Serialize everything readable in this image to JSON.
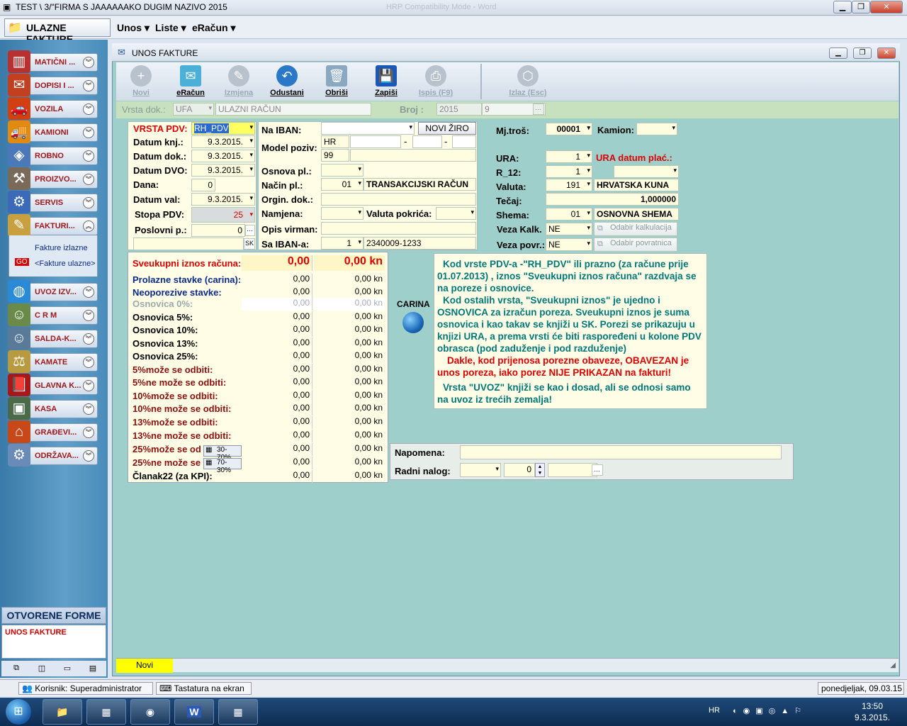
{
  "window": {
    "title": "TEST \\ 3/\"FIRMA S JAAAAAAKO DUGIM NAZIVO  2015",
    "faded_title": "HRP Compatibility Mode - Word"
  },
  "menu": {
    "app_label": "ULAZNE FAKTURE",
    "items": [
      "Unos",
      "Liste",
      "eRačun"
    ]
  },
  "sidebar": {
    "items": [
      "MATIČNI ...",
      "DOPISI I ...",
      "VOZILA",
      "KAMIONI",
      "ROBNO",
      "PROIZVO...",
      "SERVIS",
      "FAKTURI...",
      "UVOZ IZV...",
      "C R M",
      "SALDA-K...",
      "KAMATE",
      "GLAVNA K...",
      "KASA",
      "GRAĐEVI...",
      "ODRŽAVA..."
    ],
    "sub_items": [
      "Fakture izlazne",
      "<Fakture ulazne>"
    ],
    "open_forms_title": "OTVORENE FORME",
    "open_forms": [
      "UNOS FAKTURE"
    ]
  },
  "form": {
    "title": "UNOS FAKTURE",
    "toolbar": [
      {
        "label": "Novi",
        "enabled": false
      },
      {
        "label": "eRačun",
        "enabled": true
      },
      {
        "label": "Izmjena",
        "enabled": false
      },
      {
        "label": "Odustani",
        "enabled": true
      },
      {
        "label": "Obriši",
        "enabled": true
      },
      {
        "label": "Zapiši",
        "enabled": true
      },
      {
        "label": "Ispis (F9)",
        "enabled": false
      },
      {
        "label": "Izlaz (Esc)",
        "enabled": false
      }
    ],
    "header": {
      "vrsta_label": "Vrsta dok.:",
      "vrsta_code": "UFA",
      "vrsta_name": "ULAZNI RAČUN",
      "broj_label": "Broj :",
      "broj_year": "2015",
      "broj_num": "9"
    },
    "left": {
      "vrsta_pdv_label": "VRSTA PDV:",
      "vrsta_pdv": "RH_PDV",
      "datum_knj_label": "Datum knj.:",
      "datum_knj": "9.3.2015.",
      "datum_dok_label": "Datum dok.:",
      "datum_dok": "9.3.2015.",
      "datum_dvo_label": "Datum DVO:",
      "datum_dvo": "9.3.2015.",
      "dana_label": "Dana:",
      "dana": "0",
      "datum_val_label": "Datum val:",
      "datum_val": "9.3.2015.",
      "stopa_label": "Stopa PDV:",
      "stopa": "25",
      "poslovni_label": "Poslovni p.:",
      "poslovni": "0",
      "sk": "SK"
    },
    "mid": {
      "iban_label": "Na IBAN:",
      "novi_ziro": "NOVI ŽIRO",
      "model_label": "Model poziv:",
      "model_hr": "HR",
      "model_99": "99",
      "osnova_label": "Osnova pl.:",
      "nacin_label": "Način pl.:",
      "nacin_code": "01",
      "nacin_name": "TRANSAKCIJSKI RAČUN",
      "orgin_label": "Orgin. dok.:",
      "namjena_label": "Namjena:",
      "valuta_pok_label": "Valuta pokrića:",
      "opis_label": "Opis virman:",
      "sa_iban_label": "Sa IBAN-a:",
      "sa_iban_code": "1",
      "sa_iban": "2340009-1233"
    },
    "right": {
      "mjtros_label": "Mj.troš:",
      "mjtros": "00001",
      "kamion_label": "Kamion:",
      "ura_label": "URA:",
      "ura": "1",
      "ura_datum_label": "URA datum plać.:",
      "r12_label": "R_12:",
      "r12": "1",
      "valuta_label": "Valuta:",
      "valuta_code": "191",
      "valuta_name": "HRVATSKA KUNA",
      "tecaj_label": "Tečaj:",
      "tecaj": "1,000000",
      "shema_label": "Shema:",
      "shema_code": "01",
      "shema_name": "OSNOVNA SHEMA",
      "veza_kalk_label": "Veza Kalk.",
      "veza_kalk": "NE",
      "odabir_kalk": "Odabir kalkulacija",
      "veza_povr_label": "Veza povr.:",
      "veza_povr": "NE",
      "odabir_povr": "Odabir povratnica"
    },
    "amounts": {
      "total_label": "Sveukupni iznos računa:",
      "total1": "0,00",
      "total2": "0,00 kn",
      "rows": [
        {
          "label": "Prolazne stavke (carina):",
          "v1": "0,00",
          "v2": "0,00 kn",
          "color": "#0a2a8a"
        },
        {
          "label": "Neoporezive stavke:",
          "v1": "0,00",
          "v2": "0,00 kn",
          "color": "#0a2a8a"
        },
        {
          "label": "Osnovica 0%:",
          "v1": "0,00",
          "v2": "0,00 kn",
          "color": "#9aa"
        },
        {
          "label": "Osnovica 5%:",
          "v1": "0,00",
          "v2": "0,00 kn",
          "color": "#000"
        },
        {
          "label": "Osnovica 10%:",
          "v1": "0,00",
          "v2": "0,00 kn",
          "color": "#000"
        },
        {
          "label": "Osnovica 13%:",
          "v1": "0,00",
          "v2": "0,00 kn",
          "color": "#000"
        },
        {
          "label": "Osnovica 25%:",
          "v1": "0,00",
          "v2": "0,00 kn",
          "color": "#000"
        },
        {
          "label": "5%može se odbiti:",
          "v1": "0,00",
          "v2": "0,00 kn",
          "color": "#8a1010"
        },
        {
          "label": "5%ne može se odbiti:",
          "v1": "0,00",
          "v2": "0,00 kn",
          "color": "#8a1010"
        },
        {
          "label": "10%može se odbiti:",
          "v1": "0,00",
          "v2": "0,00 kn",
          "color": "#8a1010"
        },
        {
          "label": "10%ne može se odbiti:",
          "v1": "0,00",
          "v2": "0,00 kn",
          "color": "#8a1010"
        },
        {
          "label": "13%može se odbiti:",
          "v1": "0,00",
          "v2": "0,00 kn",
          "color": "#8a1010"
        },
        {
          "label": "13%ne može se odbiti:",
          "v1": "0,00",
          "v2": "0,00 kn",
          "color": "#8a1010"
        },
        {
          "label": "25%može se od",
          "v1": "0,00",
          "v2": "0,00 kn",
          "color": "#8a1010"
        },
        {
          "label": "25%ne može se",
          "v1": "0,00",
          "v2": "0,00 kn",
          "color": "#8a1010"
        },
        {
          "label": "Članak22 (za KPI):",
          "v1": "0,00",
          "v2": "0,00 kn",
          "color": "#000"
        }
      ],
      "split1": "30-70%",
      "split2": "70-30%"
    },
    "carina_label": "CARINA",
    "info": {
      "p1": "Kod vrste PDV-a -\"RH_PDV\" ili prazno (za račune prije 01.07.2013) , iznos \"Sveukupni iznos računa\" razdvaja se na poreze i osnovice.",
      "p2": "Kod ostalih vrsta, \"Sveukupni iznos\" je ujedno i OSNOVICA za izračun poreza. Sveukupni iznos je suma osnovica i kao takav se knjiži u SK.  Porezi se prikazuju u knjizi URA, a prema vrsti će biti raspoređeni u kolone PDV obrasca (pod zaduženje i pod razduženje)",
      "p3": "Dakle, kod prijenosa porezne obaveze, OBAVEZAN je unos poreza, iako porez NIJE PRIKAZAN na fakturi!",
      "p4": "Vrsta \"UVOZ\" knjiži se kao i dosad, ali se odnosi samo na uvoz iz trećih zemalja!"
    },
    "napomena_label": "Napomena:",
    "radni_label": "Radni nalog:",
    "radni_num": "0",
    "status_mode": "Novi"
  },
  "statusbar": {
    "user": "Korisnik: Superadministrator",
    "keyboard": "Tastatura na ekran",
    "date": "ponedjeljak, 09.03.15"
  },
  "taskbar": {
    "lang": "HR",
    "time": "13:50",
    "date": "9.3.2015."
  }
}
